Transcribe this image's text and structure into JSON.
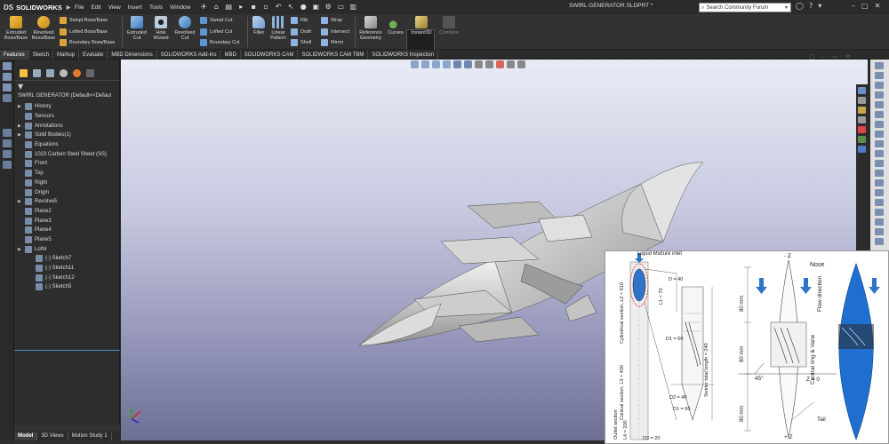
{
  "app": {
    "logo_brand": "DS",
    "logo_name": "SOLIDWORKS",
    "document_title": "SWIRL GENERATOR.SLDPRT *"
  },
  "menus": [
    "File",
    "Edit",
    "View",
    "Insert",
    "Tools",
    "Window"
  ],
  "search": {
    "placeholder": "Search Community Forum"
  },
  "ribbon": {
    "extruded_boss": "Extruded Boss/Base",
    "revolved_boss": "Revolved Boss/Base",
    "swept_boss": "Swept Boss/Base",
    "lofted_boss": "Lofted Boss/Base",
    "boundary_boss": "Boundary Boss/Base",
    "extruded_cut": "Extruded Cut",
    "hole_wizard": "Hole Wizard",
    "revolved_cut": "Revolved Cut",
    "swept_cut": "Swept Cut",
    "lofted_cut": "Lofted Cut",
    "boundary_cut": "Boundary Cut",
    "fillet": "Fillet",
    "linear_pattern": "Linear Pattern",
    "rib": "Rib",
    "draft": "Draft",
    "shell": "Shell",
    "wrap": "Wrap",
    "intersect": "Intersect",
    "mirror": "Mirror",
    "reference_geometry": "Reference Geometry",
    "curves": "Curves",
    "instant3d": "Instant3D",
    "combine": "Combine"
  },
  "command_tabs": [
    "Features",
    "Sketch",
    "Markup",
    "Evaluate",
    "MBD Dimensions",
    "SOLIDWORKS Add-Ins",
    "MBD",
    "SOLIDWORKS CAM",
    "SOLIDWORKS CAM TBM",
    "SOLIDWORKS Inspection"
  ],
  "feature_tree": {
    "root": "SWIRL GENERATOR  (Default<<Defaul",
    "items": [
      {
        "label": "History",
        "expandable": true,
        "indent": 0
      },
      {
        "label": "Sensors",
        "expandable": false,
        "indent": 0
      },
      {
        "label": "Annotations",
        "expandable": true,
        "indent": 0
      },
      {
        "label": "Solid Bodies(1)",
        "expandable": true,
        "indent": 0
      },
      {
        "label": "Equations",
        "expandable": false,
        "indent": 0
      },
      {
        "label": "1023 Carbon Steel Sheet (SS)",
        "expandable": false,
        "indent": 0
      },
      {
        "label": "Front",
        "expandable": false,
        "indent": 0
      },
      {
        "label": "Top",
        "expandable": false,
        "indent": 0
      },
      {
        "label": "Right",
        "expandable": false,
        "indent": 0
      },
      {
        "label": "Origin",
        "expandable": false,
        "indent": 0
      },
      {
        "label": "Revolve5",
        "expandable": true,
        "indent": 0
      },
      {
        "label": "Plane2",
        "expandable": false,
        "indent": 0
      },
      {
        "label": "Plane3",
        "expandable": false,
        "indent": 0
      },
      {
        "label": "Plane4",
        "expandable": false,
        "indent": 0
      },
      {
        "label": "Plane5",
        "expandable": false,
        "indent": 0
      },
      {
        "label": "Loft4",
        "expandable": true,
        "indent": 0
      },
      {
        "label": "(-) Sketch7",
        "expandable": false,
        "indent": 1
      },
      {
        "label": "(-) Sketch11",
        "expandable": false,
        "indent": 1
      },
      {
        "label": "(-) Sketch12",
        "expandable": false,
        "indent": 1
      },
      {
        "label": "(-) Sketch5",
        "expandable": false,
        "indent": 1
      }
    ]
  },
  "bottom_tabs": [
    "Model",
    "3D Views",
    "Motion Study 1"
  ],
  "inset": {
    "left_drawing": {
      "inlet": "Liquid Mixture inlet",
      "d40_top": "D = 40",
      "l1": "L1 = 70",
      "cyl": "Cylindrical section, L2 = 610",
      "d1": "D1 = 60",
      "swirler_len": "Swirler total length = 240",
      "conical": "Conical section, L3 = 430",
      "d2": "D2 = 40",
      "d1b": "D1 = 60",
      "outlet": "Outlet section",
      "l4": "L4 = 200",
      "d3": "D3 = 20"
    },
    "right_drawing": {
      "minus_z": "- Z",
      "nose": "Nose",
      "flow": "Flow direction",
      "mm80a": "80 mm",
      "mm80b": "80 mm",
      "mm80c": "80 mm",
      "central": "Central ring & Vane",
      "angle": "45°",
      "z0": "Z = 0",
      "tail": "Tail",
      "plus_z": "+ Z"
    }
  },
  "colors": {
    "accent_blue": "#4a8cd6",
    "background_dark": "#2b2b2b",
    "model_gray": "#cfcfcf",
    "inset_blue": "#1f6fd1"
  }
}
